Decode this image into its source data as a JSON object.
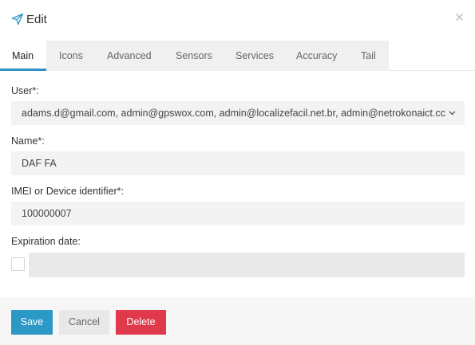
{
  "modal": {
    "title": "Edit",
    "title_icon": "paper-plane-icon",
    "close_glyph": "×"
  },
  "tabs": [
    {
      "label": "Main",
      "active": true
    },
    {
      "label": "Icons",
      "active": false
    },
    {
      "label": "Advanced",
      "active": false
    },
    {
      "label": "Sensors",
      "active": false
    },
    {
      "label": "Services",
      "active": false
    },
    {
      "label": "Accuracy",
      "active": false
    },
    {
      "label": "Tail",
      "active": false
    }
  ],
  "form": {
    "user_label": "User*:",
    "user_value": "adams.d@gmail.com, admin@gpswox.com, admin@localizefacil.net.br, admin@netrokonaict.cc",
    "name_label": "Name*:",
    "name_value": "DAF FA",
    "imei_label": "IMEI or Device identifier*:",
    "imei_value": "100000007",
    "expiration_label": "Expiration date:",
    "expiration_enabled": false
  },
  "footer": {
    "save_label": "Save",
    "cancel_label": "Cancel",
    "delete_label": "Delete"
  },
  "colors": {
    "accent": "#2c98c5",
    "danger": "#e0394b",
    "tab_underline": "#2f92c2"
  }
}
